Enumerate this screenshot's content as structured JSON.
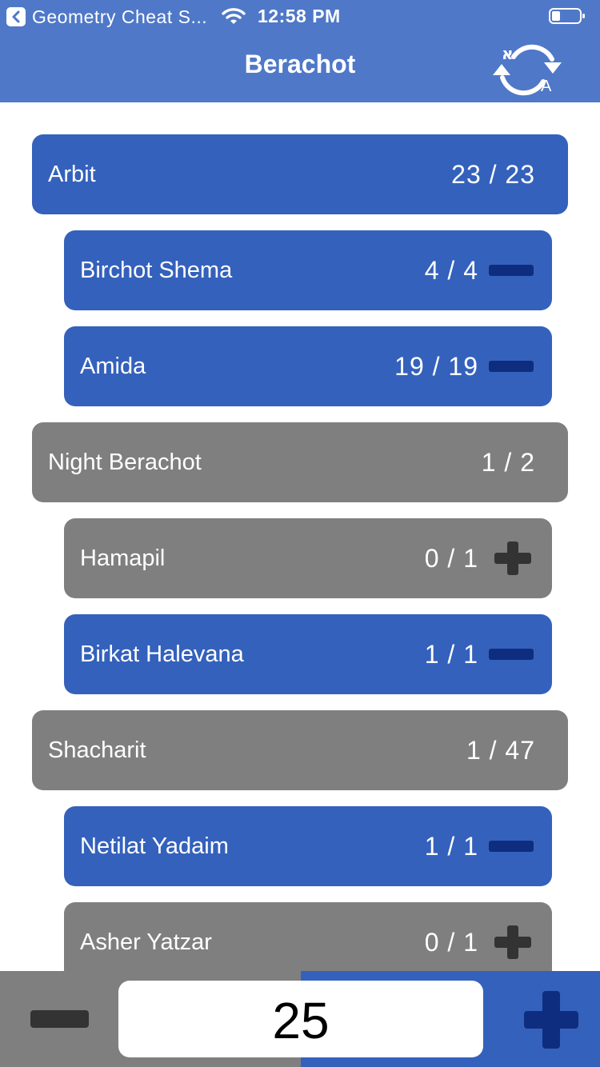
{
  "status_bar": {
    "back_app_label": "Geometry Cheat S...",
    "time": "12:58 PM"
  },
  "nav": {
    "title": "Berachot",
    "toggle_icon": "hebrew-english-cycle-icon"
  },
  "colors": {
    "header": "#4f78c8",
    "active": "#3461bc",
    "inactive": "#7f7f7f",
    "active_icon": "#0f2d7e",
    "inactive_icon": "#333333"
  },
  "list": {
    "rows": [
      {
        "label": "Arbit",
        "count": "23 / 23"
      },
      {
        "label": "Birchot Shema",
        "count": "4 / 4"
      },
      {
        "label": "Amida",
        "count": "19 / 19"
      },
      {
        "label": "Night Berachot",
        "count": "1 / 2"
      },
      {
        "label": "Hamapil",
        "count": "0 / 1"
      },
      {
        "label": "Birkat Halevana",
        "count": "1 / 1"
      },
      {
        "label": "Shacharit",
        "count": "1 / 47"
      },
      {
        "label": "Netilat Yadaim",
        "count": "1 / 1"
      },
      {
        "label": "Asher Yatzar",
        "count": "0 / 1"
      }
    ]
  },
  "stepper": {
    "value": "25"
  }
}
